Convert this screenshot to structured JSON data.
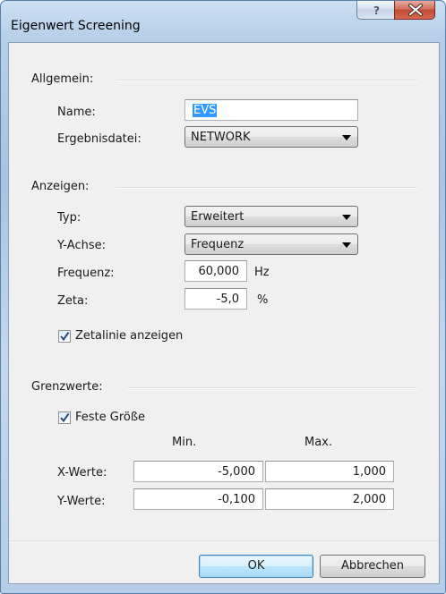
{
  "window": {
    "title": "Eigenwert Screening"
  },
  "allgemein": {
    "group_label": "Allgemein:",
    "name_label": "Name:",
    "name_value": "EVS",
    "file_label": "Ergebnisdatei:",
    "file_value": "NETWORK"
  },
  "anzeigen": {
    "group_label": "Anzeigen:",
    "typ_label": "Typ:",
    "typ_value": "Erweitert",
    "yachse_label": "Y-Achse:",
    "yachse_value": "Frequenz",
    "frequenz_label": "Frequenz:",
    "frequenz_value": "60,000",
    "frequenz_unit": "Hz",
    "zeta_label": "Zeta:",
    "zeta_value": "-5,0",
    "zeta_unit": "%",
    "zetalinie_label": "Zetalinie anzeigen",
    "zetalinie_checked": true
  },
  "grenzwerte": {
    "group_label": "Grenzwerte:",
    "feste_label": "Feste Größe",
    "feste_checked": true,
    "col_min": "Min.",
    "col_max": "Max.",
    "x_label": "X-Werte:",
    "x_min": "-5,000",
    "x_max": "1,000",
    "y_label": "Y-Werte:",
    "y_min": "-0,100",
    "y_max": "2,000"
  },
  "buttons": {
    "ok": "OK",
    "cancel": "Abbrechen"
  },
  "icons": {
    "help": "help-icon",
    "close": "close-icon",
    "dropdown": "chevron-down-icon",
    "checkbox": "checkmark-icon"
  },
  "colors": {
    "selection": "#3399ff",
    "close_button": "#c9503a",
    "frame": "#b7cfe9"
  }
}
